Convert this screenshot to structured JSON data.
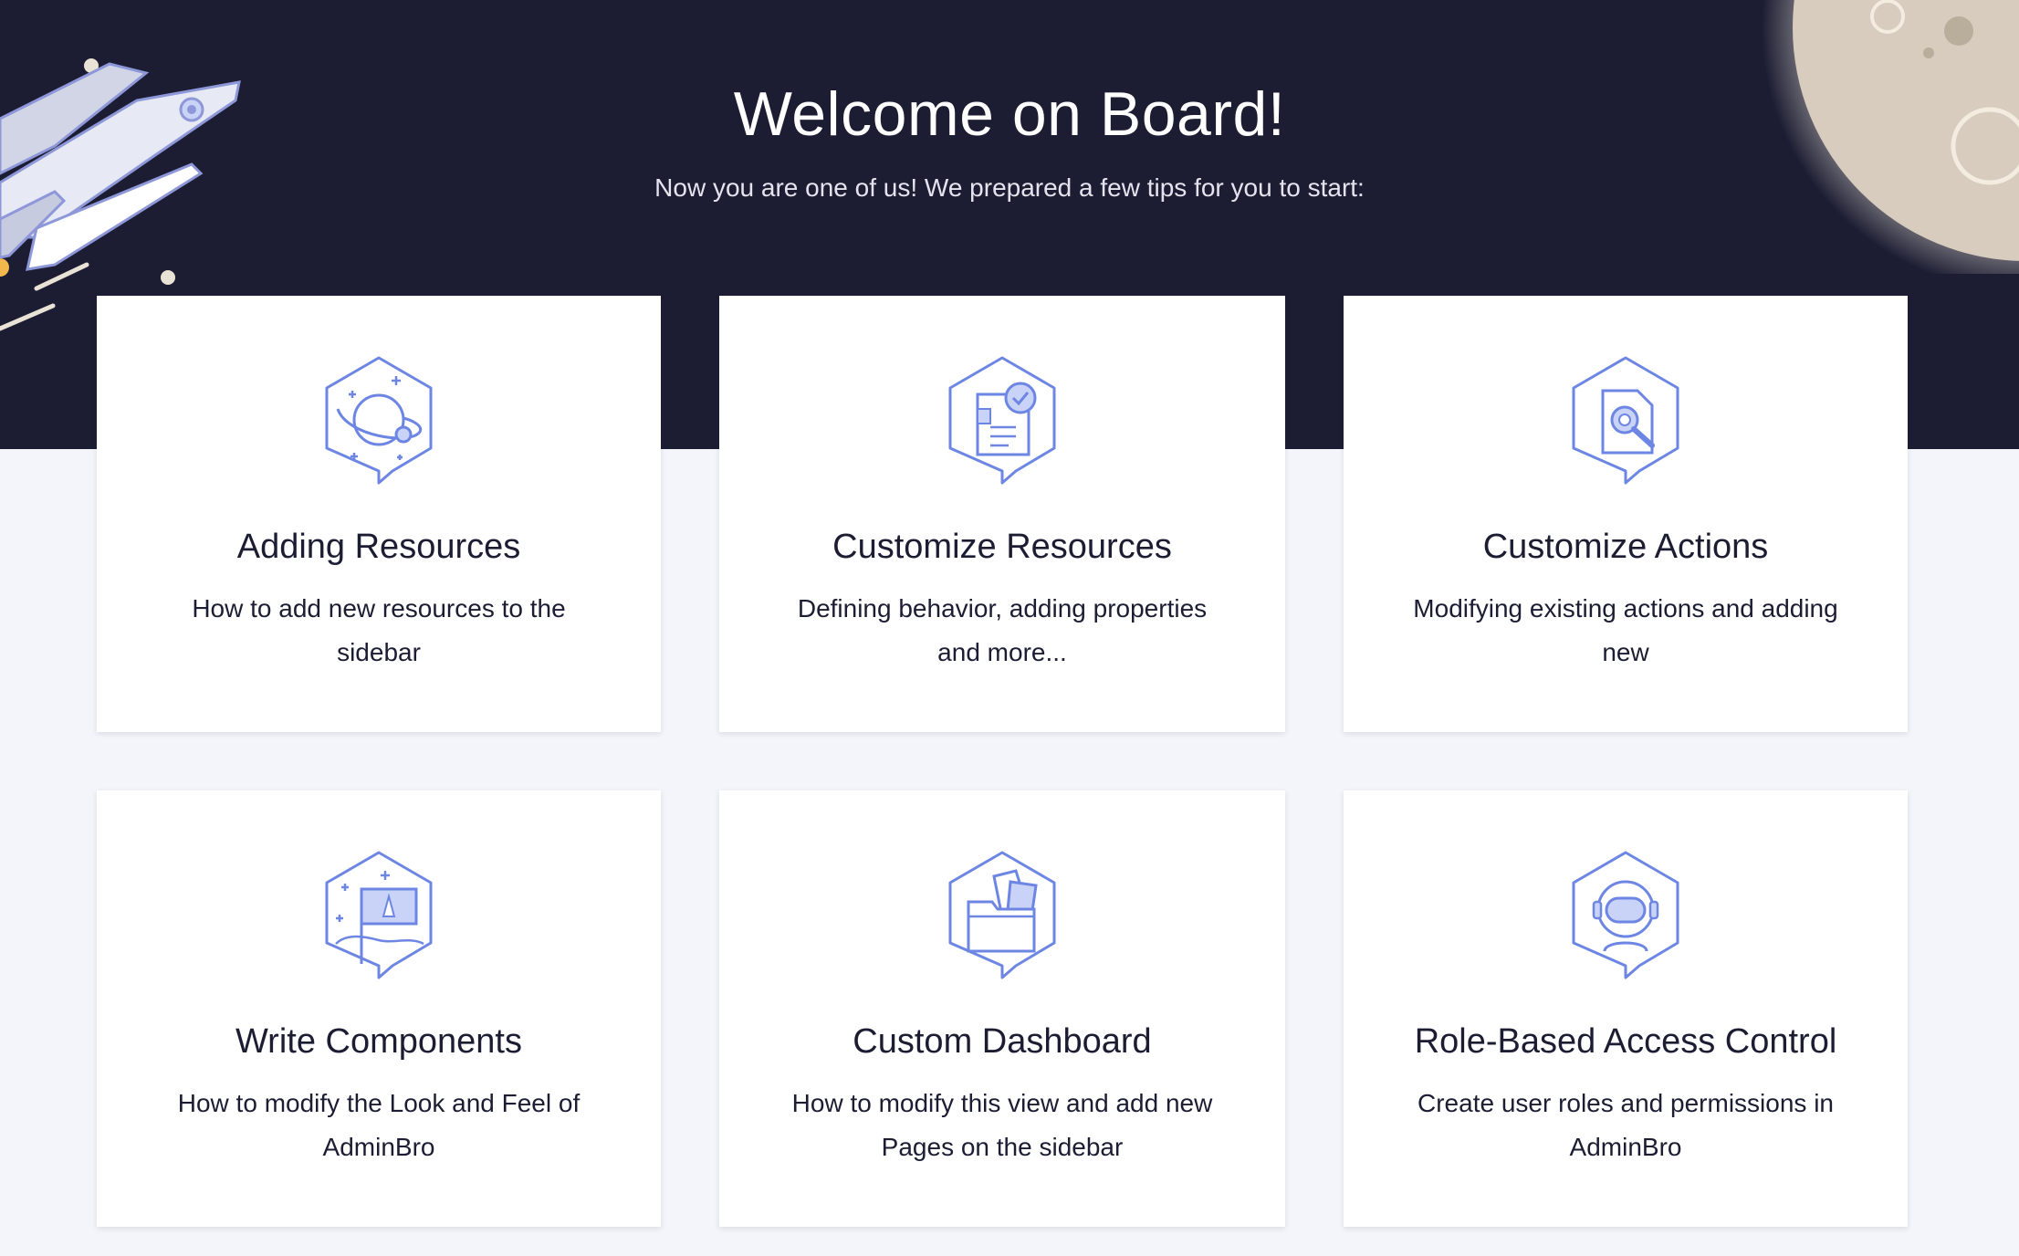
{
  "hero": {
    "title": "Welcome on Board!",
    "subtitle": "Now you are one of us! We prepared a few tips for you to start:"
  },
  "cards": [
    {
      "title": "Adding Resources",
      "description": "How to add new resources to the sidebar",
      "icon": "planet-icon"
    },
    {
      "title": "Customize Resources",
      "description": "Defining behavior, adding properties and more...",
      "icon": "document-check-icon"
    },
    {
      "title": "Customize Actions",
      "description": "Modifying existing actions and adding new",
      "icon": "document-search-icon"
    },
    {
      "title": "Write Components",
      "description": "How to modify the Look and Feel of AdminBro",
      "icon": "flag-icon"
    },
    {
      "title": "Custom Dashboard",
      "description": "How to modify this view and add new Pages on the sidebar",
      "icon": "folder-icon"
    },
    {
      "title": "Role-Based Access Control",
      "description": "Create user roles and permissions in AdminBro",
      "icon": "astronaut-icon"
    }
  ],
  "colors": {
    "hero_background": "#1c1d33",
    "page_background": "#f4f5fa",
    "icon_stroke": "#6d86e4",
    "icon_fill": "#c9d3f7",
    "moon": "#d7ccbd"
  }
}
